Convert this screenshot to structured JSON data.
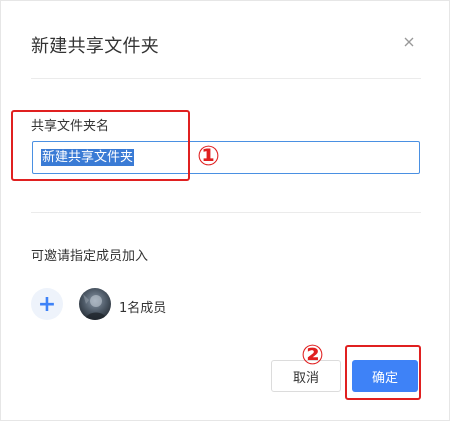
{
  "dialog": {
    "title": "新建共享文件夹",
    "close_icon": "close-icon"
  },
  "form": {
    "folder_name_label": "共享文件夹名",
    "folder_name_value": "新建共享文件夹",
    "value_selected": true
  },
  "members": {
    "invite_label": "可邀请指定成员加入",
    "add_icon": "plus-icon",
    "add_symbol": "+",
    "count_text": "1名成员"
  },
  "annotations": {
    "marker_1": "①",
    "marker_2": "②",
    "box_color": "#e02020"
  },
  "footer": {
    "cancel_label": "取消",
    "confirm_label": "确定"
  },
  "colors": {
    "primary": "#3e82f7",
    "input_focus_border": "#4a90e2",
    "selection": "#3a7bd5"
  }
}
